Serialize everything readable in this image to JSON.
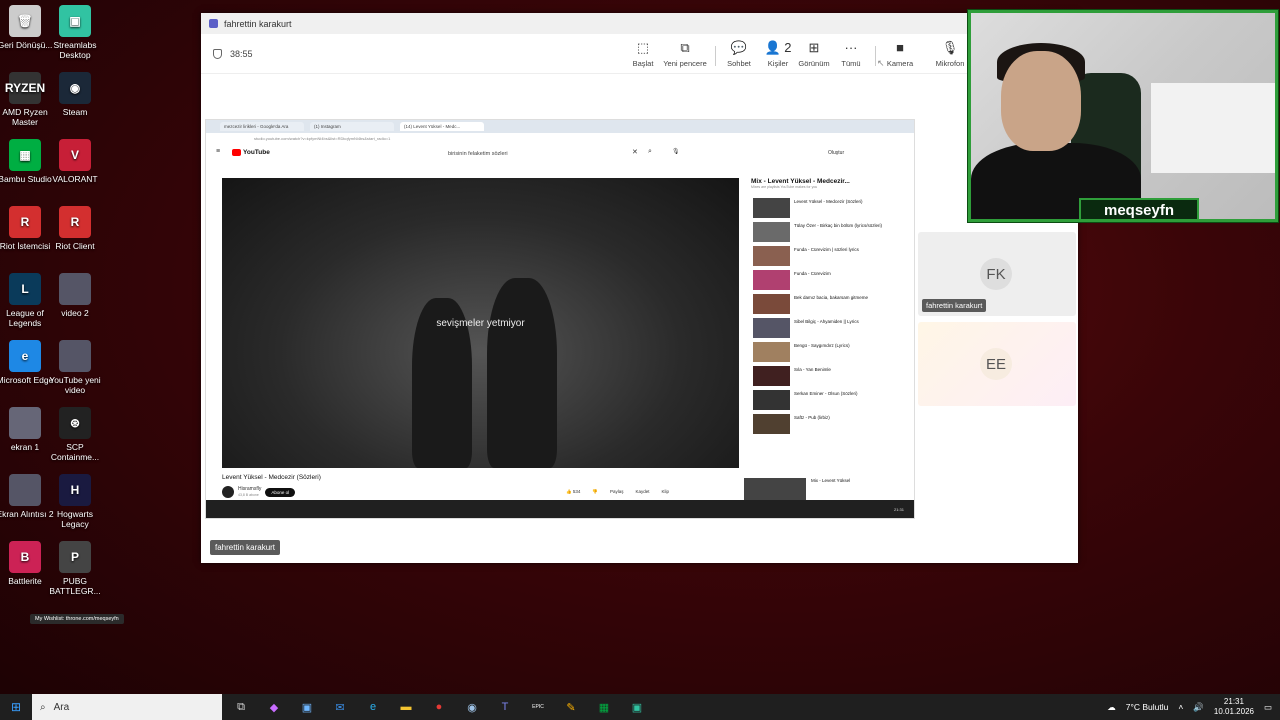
{
  "desktop": {
    "icons": [
      {
        "label": "Geri Dönüşü...",
        "icon": "recycle-bin-icon",
        "glyph": "🗑"
      },
      {
        "label": "Streamlabs Desktop",
        "icon": "streamlabs-icon",
        "glyph": "▣"
      },
      {
        "label": "AMD Ryzen Master",
        "icon": "ryzen-icon",
        "glyph": "RYZEN"
      },
      {
        "label": "Steam",
        "icon": "steam-icon",
        "glyph": "◉"
      },
      {
        "label": "Bambu Studio",
        "icon": "bambu-icon",
        "glyph": "▦"
      },
      {
        "label": "VALORANT",
        "icon": "valorant-icon",
        "glyph": "V"
      },
      {
        "label": "Riot İstemcisi",
        "icon": "riot-client-icon",
        "glyph": "R"
      },
      {
        "label": "Riot Client",
        "icon": "riot-client-icon",
        "glyph": "R"
      },
      {
        "label": "League of Legends",
        "icon": "league-icon",
        "glyph": "L"
      },
      {
        "label": "video 2",
        "icon": "video-thumbnail-icon",
        "glyph": ""
      },
      {
        "label": "Microsoft Edge",
        "icon": "edge-icon",
        "glyph": "e"
      },
      {
        "label": "YouTube yeni video",
        "icon": "video-thumbnail-icon",
        "glyph": ""
      },
      {
        "label": "ekran 1",
        "icon": "image-thumbnail-icon",
        "glyph": ""
      },
      {
        "label": "SCP Containme...",
        "icon": "scp-icon",
        "glyph": "⊛"
      },
      {
        "label": "Ekran Alıntısı 2",
        "icon": "image-thumbnail-icon",
        "glyph": ""
      },
      {
        "label": "Hogwarts Legacy",
        "icon": "hogwarts-icon",
        "glyph": "H"
      },
      {
        "label": "Battlerite",
        "icon": "battlerite-icon",
        "glyph": "B"
      },
      {
        "label": "PUBG BATTLEGR...",
        "icon": "pubg-icon",
        "glyph": "P"
      }
    ],
    "wishlist_tooltip": "My Wishlist: throne.com/meqseyfn"
  },
  "teams": {
    "window_title": "fahrettin karakurt",
    "timer": "38:55",
    "toolbar": [
      {
        "label": "Başlat",
        "icon": "share-screen-icon",
        "glyph": "⬚"
      },
      {
        "label": "Yeni pencere",
        "icon": "new-window-icon",
        "glyph": "⧉"
      },
      {
        "label": "Sohbet",
        "icon": "chat-icon",
        "glyph": "💬"
      },
      {
        "label": "Kişiler",
        "icon": "people-icon",
        "glyph": "👤"
      },
      {
        "label": "Görünüm",
        "icon": "view-icon",
        "glyph": "⊞"
      },
      {
        "label": "Tümü",
        "icon": "more-icon",
        "glyph": "···"
      },
      {
        "label": "Kamera",
        "icon": "camera-off-icon",
        "glyph": "■"
      },
      {
        "label": "Mikrofon",
        "icon": "microphone-icon",
        "glyph": "🎙"
      }
    ],
    "people_count": "2",
    "presenter_tag": "fahrettin karakurt",
    "participants": [
      {
        "initials": "FK",
        "name": "fahrettin karakurt"
      },
      {
        "initials": "EE",
        "name": ""
      }
    ]
  },
  "shared_screen": {
    "tabs": [
      "mezcezir lirikleri - Google'da Ara",
      "(1) Instagram",
      "(14) Levent Yüksel - Medc..."
    ],
    "address": "studio.youtube.com/watch?v=kpfymNi4bs&list=RDkqfymNi4bs&start_radio=1",
    "search_query": "birisinin felaketim sözleri",
    "youtube_logo": "YouTube",
    "create_label": "Oluştur",
    "caption": "sevişmeler yetmiyor",
    "video_title": "Levent Yüksel - Medcezir (Sözleri)",
    "channel": "Hisramsfly",
    "channel_subs": "43,8 B abone",
    "subscribe": "Abone ol",
    "likes": "534",
    "actions": [
      "Paylaş",
      "Kaydet",
      "Klip"
    ],
    "mix_title": "Mix - Levent Yüksel - Medcezir...",
    "mix_subtitle": "Mixes are playlists YouTube makes for you",
    "mix_items": [
      "Levent Yüksel - Medcezir (Sözleri)",
      "Tülay Özer - Birkaç bin bölüm (lyrics/sözleri)",
      "Funda - Cürevizim | sözleri lyrics",
      "Funda - Cürevizim",
      "Bek damız bacia, bakarsam gitmeme",
      "Sibel Bilgiç - Ahyamiden || Lyrics",
      "Bengü - Saygımdırz (Lyrics)",
      "Sıla - Yan Benimle",
      "Serkan Eminer - Olsun (Sözleri)",
      "Saftz - Pub (lirbiz)"
    ],
    "next_mix": "Mix - Levent Yüksel",
    "inner_clock": "21:31"
  },
  "webcam": {
    "name": "meqseyfn"
  },
  "taskbar": {
    "search_placeholder": "Ara",
    "weather": "7°C Bulutlu",
    "time": "21:31",
    "date": "10.01.2026",
    "apps": [
      {
        "icon": "task-view-icon",
        "glyph": "⧉",
        "color": "#ddd"
      },
      {
        "icon": "copilot-icon",
        "glyph": "◆",
        "color": "#c86cff"
      },
      {
        "icon": "store-icon",
        "glyph": "▣",
        "color": "#6fb7ff"
      },
      {
        "icon": "outlook-icon",
        "glyph": "✉",
        "color": "#3a8ee6"
      },
      {
        "icon": "edge-icon",
        "glyph": "e",
        "color": "#2bb0ec"
      },
      {
        "icon": "file-explorer-icon",
        "glyph": "▬",
        "color": "#f4c430"
      },
      {
        "icon": "chrome-icon",
        "glyph": "●",
        "color": "#e53935"
      },
      {
        "icon": "steam-icon",
        "glyph": "◉",
        "color": "#9ec2e6"
      },
      {
        "icon": "teams-icon",
        "glyph": "T",
        "color": "#7b83eb"
      },
      {
        "icon": "epic-games-icon",
        "glyph": "EPIC",
        "color": "#fff"
      },
      {
        "icon": "pen-icon",
        "glyph": "✎",
        "color": "#ffb300"
      },
      {
        "icon": "bambu-icon",
        "glyph": "▦",
        "color": "#00ae42"
      },
      {
        "icon": "streamlabs-icon",
        "glyph": "▣",
        "color": "#31c3a2"
      }
    ]
  }
}
